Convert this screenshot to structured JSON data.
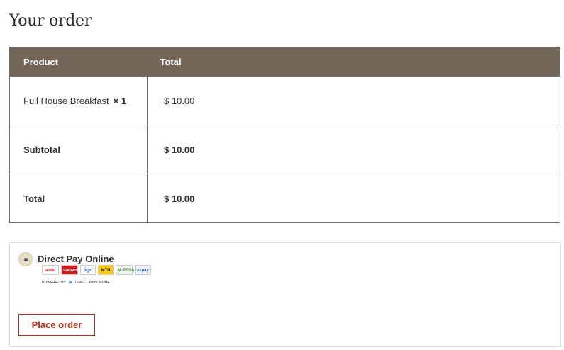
{
  "page_title": "Your order",
  "table": {
    "headers": {
      "product": "Product",
      "total": "Total"
    },
    "rows": [
      {
        "product": "Full House Breakfast",
        "quantity": "× 1",
        "total": "$ 10.00"
      }
    ],
    "subtotal": {
      "label": "Subtotal",
      "value": "$ 10.00"
    },
    "total": {
      "label": "Total",
      "value": "$ 10.00"
    }
  },
  "payment": {
    "method_label": "Direct Pay Online",
    "selected": true,
    "logos": [
      {
        "name": "airtel",
        "text": "airtel"
      },
      {
        "name": "vodacom",
        "text": "vodacom"
      },
      {
        "name": "tigo",
        "text": "tigo"
      },
      {
        "name": "mtn",
        "text": "MTN"
      },
      {
        "name": "mpesa",
        "text": "M-PESA"
      },
      {
        "name": "ezpay",
        "text": "ezpay"
      }
    ],
    "powered_by": "POWERED BY",
    "powered_brand": "DIRECT PAY ONLINE"
  },
  "actions": {
    "place_order_label": "Place order"
  },
  "colors": {
    "header_bg": "#736558",
    "button_accent": "#b3321e",
    "radio_bg": "#e9dcc4"
  }
}
